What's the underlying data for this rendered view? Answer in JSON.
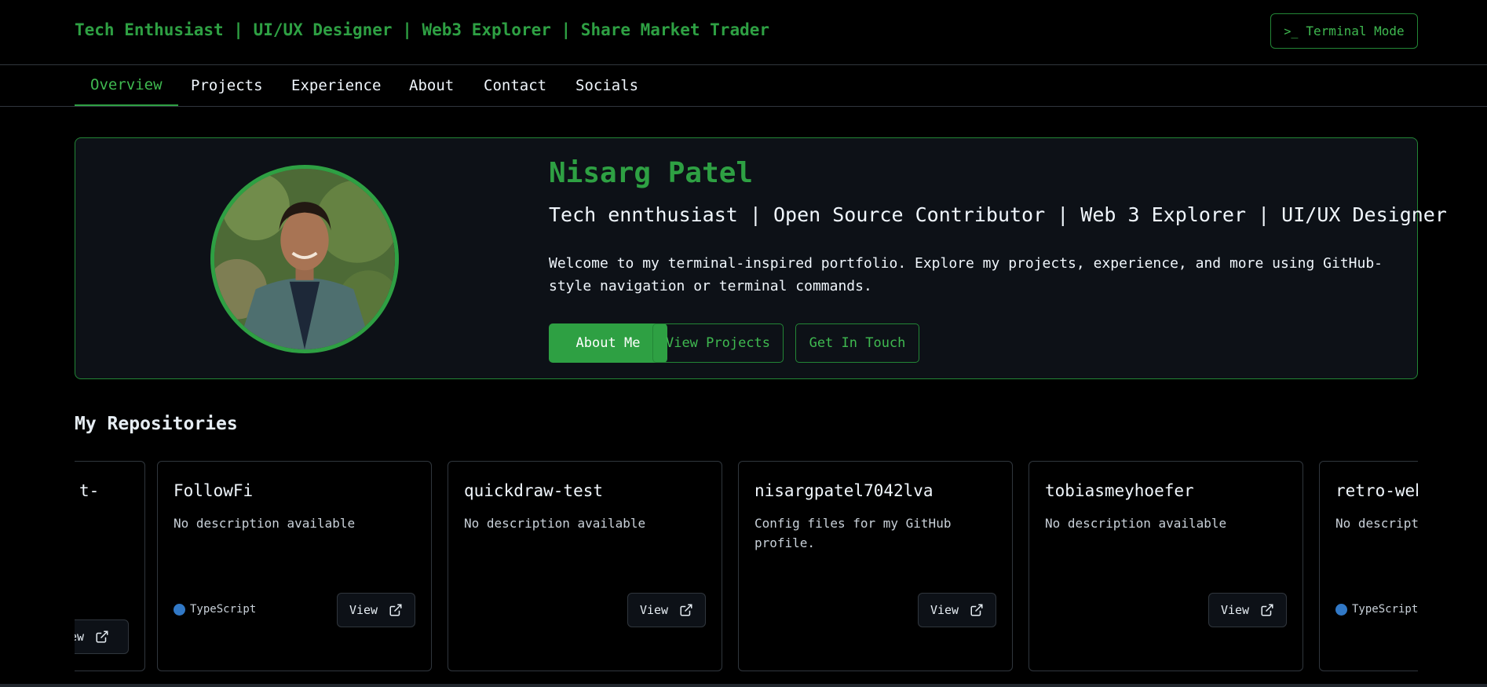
{
  "header": {
    "site_title": "Tech Enthusiast | UI/UX Designer | Web3 Explorer | Share Market Trader",
    "terminal_mode": "Terminal Mode",
    "terminal_icon": ">_"
  },
  "nav": {
    "tabs": [
      {
        "label": "Overview",
        "active": true
      },
      {
        "label": "Projects"
      },
      {
        "label": "Experience"
      },
      {
        "label": "About"
      },
      {
        "label": "Contact"
      },
      {
        "label": "Socials"
      }
    ]
  },
  "hero": {
    "name": "Nisarg Patel",
    "tagline": "Tech ennthusiast | Open Source Contributor | Web 3 Explorer | UI/UX Designer",
    "description": "Welcome to my terminal-inspired portfolio. Explore my projects, experience, and more using GitHub-style navigation or terminal commands.",
    "buttons": {
      "about": "About Me",
      "projects": "View Projects",
      "contact": "Get In Touch"
    }
  },
  "repos": {
    "title": "My Repositories",
    "view_label": "View",
    "partial_left": {
      "name_fragment": "t-",
      "view_fragment": "ew"
    },
    "items": [
      {
        "name": "FollowFi",
        "description": "No description available",
        "language": "TypeScript"
      },
      {
        "name": "quickdraw-test",
        "description": "No description available",
        "language": ""
      },
      {
        "name": "nisargpatel7042lva",
        "description": "Config files for my GitHub profile.",
        "language": ""
      },
      {
        "name": "tobiasmeyhoefer",
        "description": "No description available",
        "language": ""
      },
      {
        "name": "retro-web",
        "description": "No description available",
        "language": "TypeScript"
      }
    ]
  },
  "colors": {
    "accent": "#2ea043",
    "background": "#000000",
    "card": "#0d1117",
    "typescript": "#3178c6"
  }
}
